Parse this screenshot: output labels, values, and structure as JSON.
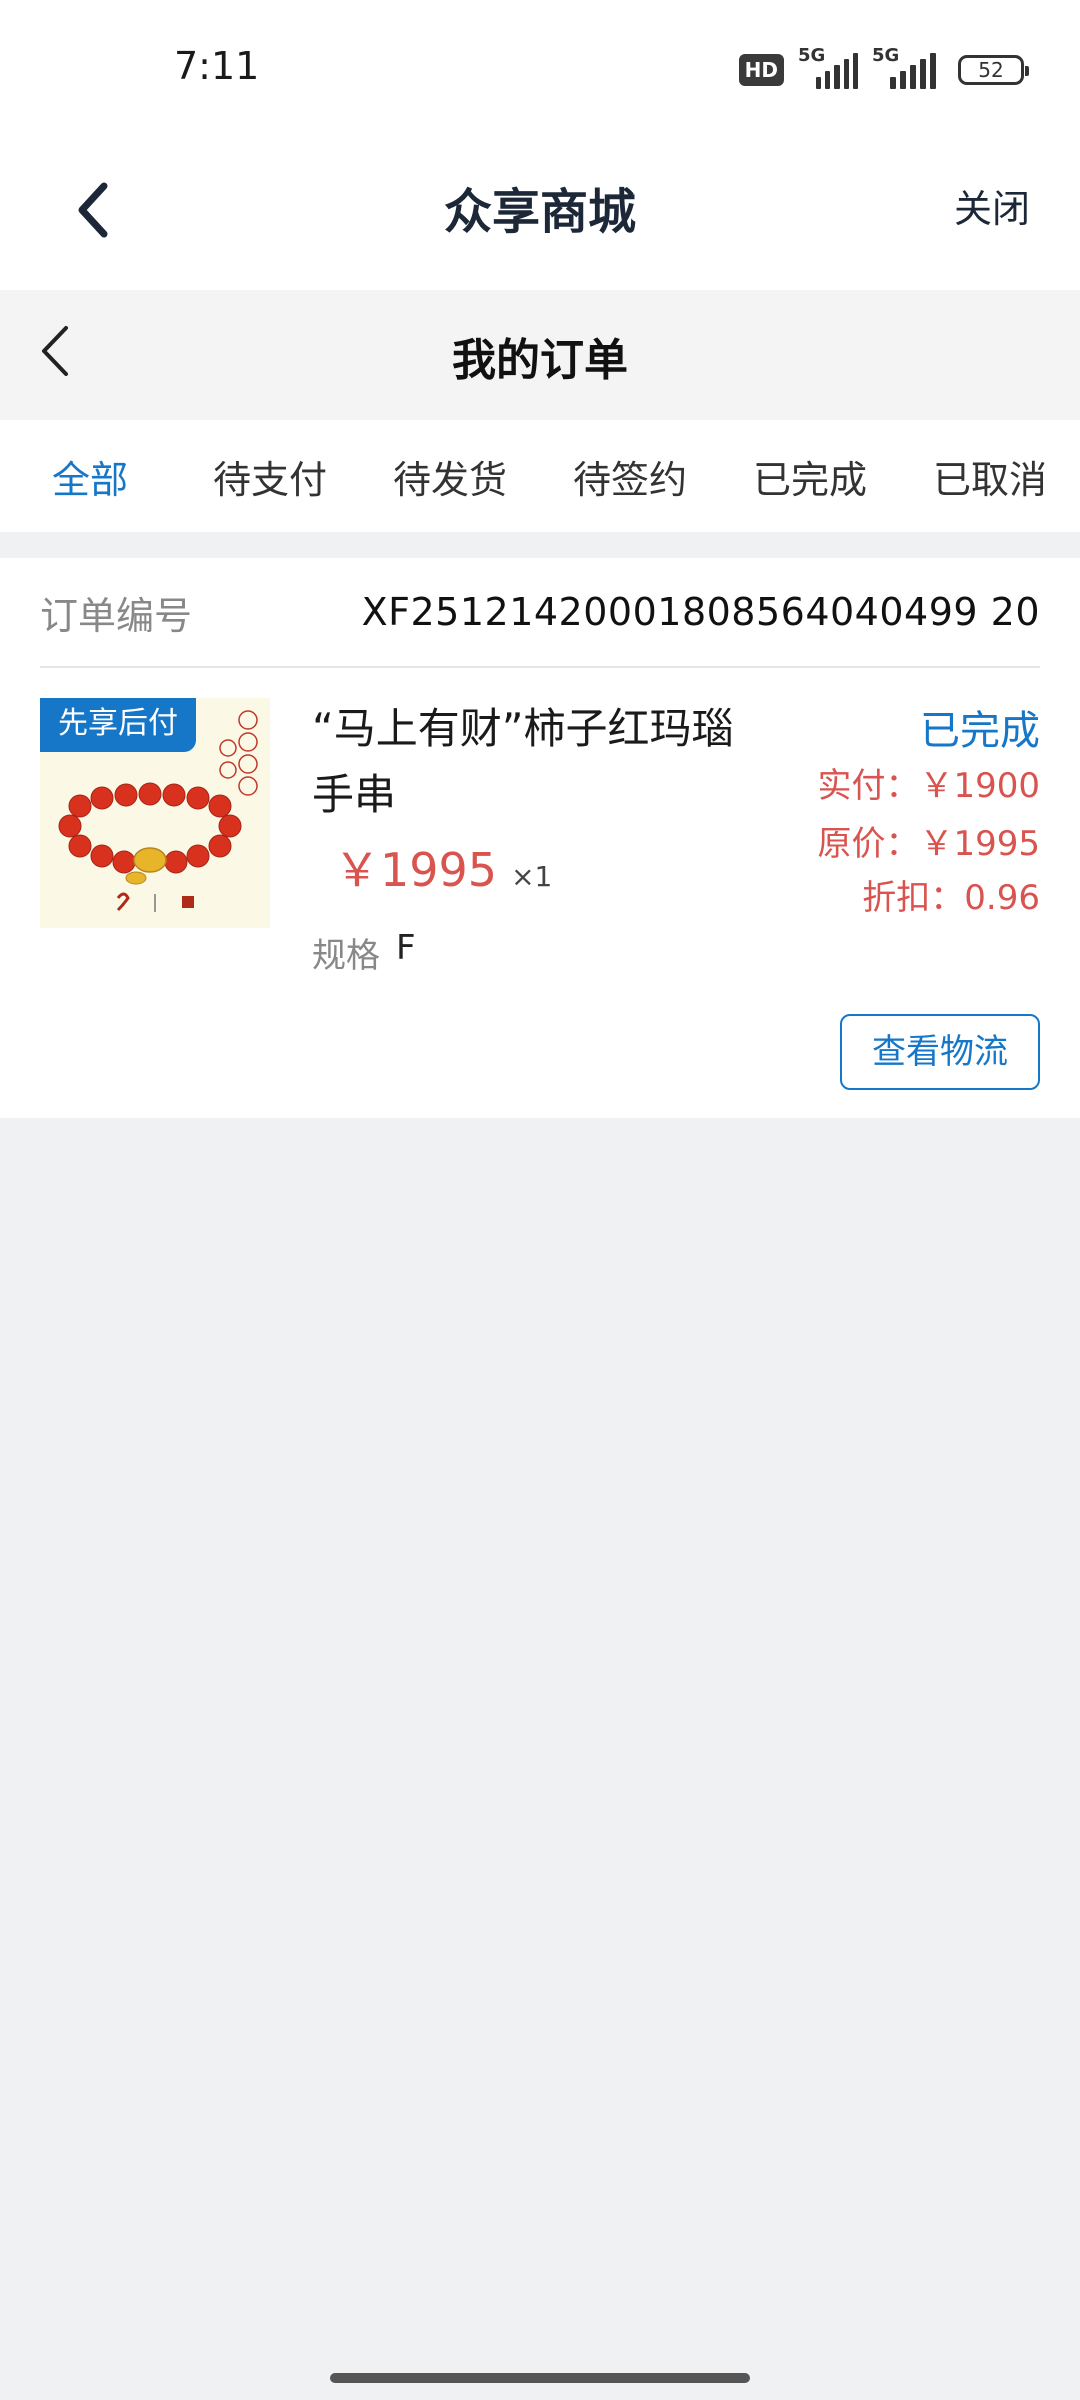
{
  "status_bar": {
    "time": "7:11",
    "hd_label": "HD",
    "sim1_label": "5G",
    "sim2_label": "5G",
    "battery": "52"
  },
  "header": {
    "title": "众享商城",
    "close_label": "关闭",
    "back_icon": "chevron-left-icon"
  },
  "sub_header": {
    "title": "我的订单",
    "back_icon": "chevron-left-icon"
  },
  "tabs": [
    {
      "label": "全部",
      "active": true
    },
    {
      "label": "待支付",
      "active": false
    },
    {
      "label": "待发货",
      "active": false
    },
    {
      "label": "待签约",
      "active": false
    },
    {
      "label": "已完成",
      "active": false
    },
    {
      "label": "已取消",
      "active": false
    }
  ],
  "order": {
    "number_label": "订单编号",
    "number": "XF25121420001808564040499 20",
    "promo_tag": "先享后付",
    "product_title": "“马上有财”柿子红玛瑙手串",
    "price": "￥1995",
    "quantity": "×1",
    "spec_label": "规格",
    "spec_value": "F",
    "status": "已完成",
    "paid": "实付：￥1900",
    "original_price": "原价：￥1995",
    "discount": "折扣：0.96",
    "logistics_button": "查看物流"
  },
  "colors": {
    "accent": "#1677c8",
    "price_red": "#d9534f",
    "page_bg": "#f0f1f3"
  }
}
